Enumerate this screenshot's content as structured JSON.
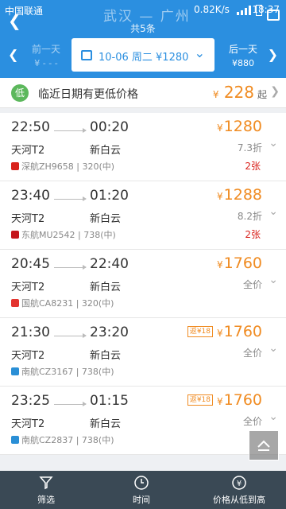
{
  "status": {
    "carrier": "中国联通",
    "net": "0.82K/s",
    "time": "18:37"
  },
  "header": {
    "title": "武汉 — 广州",
    "subtitle": "共5条"
  },
  "date_bar": {
    "prev_label": "前一天",
    "prev_price": "¥ - - -",
    "current": "10-06 周二 ¥1280",
    "next_label": "后一天",
    "next_price": "¥880"
  },
  "low_banner": {
    "badge": "低",
    "text": "临近日期有更低价格",
    "currency": "¥",
    "price": "228",
    "suffix": "起"
  },
  "flights": [
    {
      "dep_time": "22:50",
      "arr_time": "00:20",
      "dep_airport": "天河T2",
      "arr_airport": "新白云",
      "airline": "深航ZH9658 | 320(中)",
      "currency": "¥",
      "price": "1280",
      "discount": "7.3折",
      "seats": "2张",
      "fan": "",
      "logo_color": "#d9231d"
    },
    {
      "dep_time": "23:40",
      "arr_time": "01:20",
      "dep_airport": "天河T2",
      "arr_airport": "新白云",
      "airline": "东航MU2542 | 738(中)",
      "currency": "¥",
      "price": "1288",
      "discount": "8.2折",
      "seats": "2张",
      "fan": "",
      "logo_color": "#c4161c"
    },
    {
      "dep_time": "20:45",
      "arr_time": "22:40",
      "dep_airport": "天河T2",
      "arr_airport": "新白云",
      "airline": "国航CA8231 | 320(中)",
      "currency": "¥",
      "price": "1760",
      "discount": "全价",
      "seats": "",
      "fan": "",
      "logo_color": "#e3342f"
    },
    {
      "dep_time": "21:30",
      "arr_time": "23:20",
      "dep_airport": "天河T2",
      "arr_airport": "新白云",
      "airline": "南航CZ3167 | 738(中)",
      "currency": "¥",
      "price": "1760",
      "discount": "全价",
      "seats": "",
      "fan": "返¥18",
      "logo_color": "#2a8fd6"
    },
    {
      "dep_time": "23:25",
      "arr_time": "01:15",
      "dep_airport": "天河T2",
      "arr_airport": "新白云",
      "airline": "南航CZ2837 | 738(中)",
      "currency": "¥",
      "price": "1760",
      "discount": "全价",
      "seats": "",
      "fan": "返¥18",
      "logo_color": "#2a8fd6"
    }
  ],
  "bottom_bar": {
    "filter": "筛选",
    "time": "时间",
    "price_sort": "价格从低到高"
  },
  "colors": {
    "primary": "#2b8fe0",
    "price": "#f08b21",
    "seats": "#d9231d",
    "bottom": "#3a4955"
  }
}
